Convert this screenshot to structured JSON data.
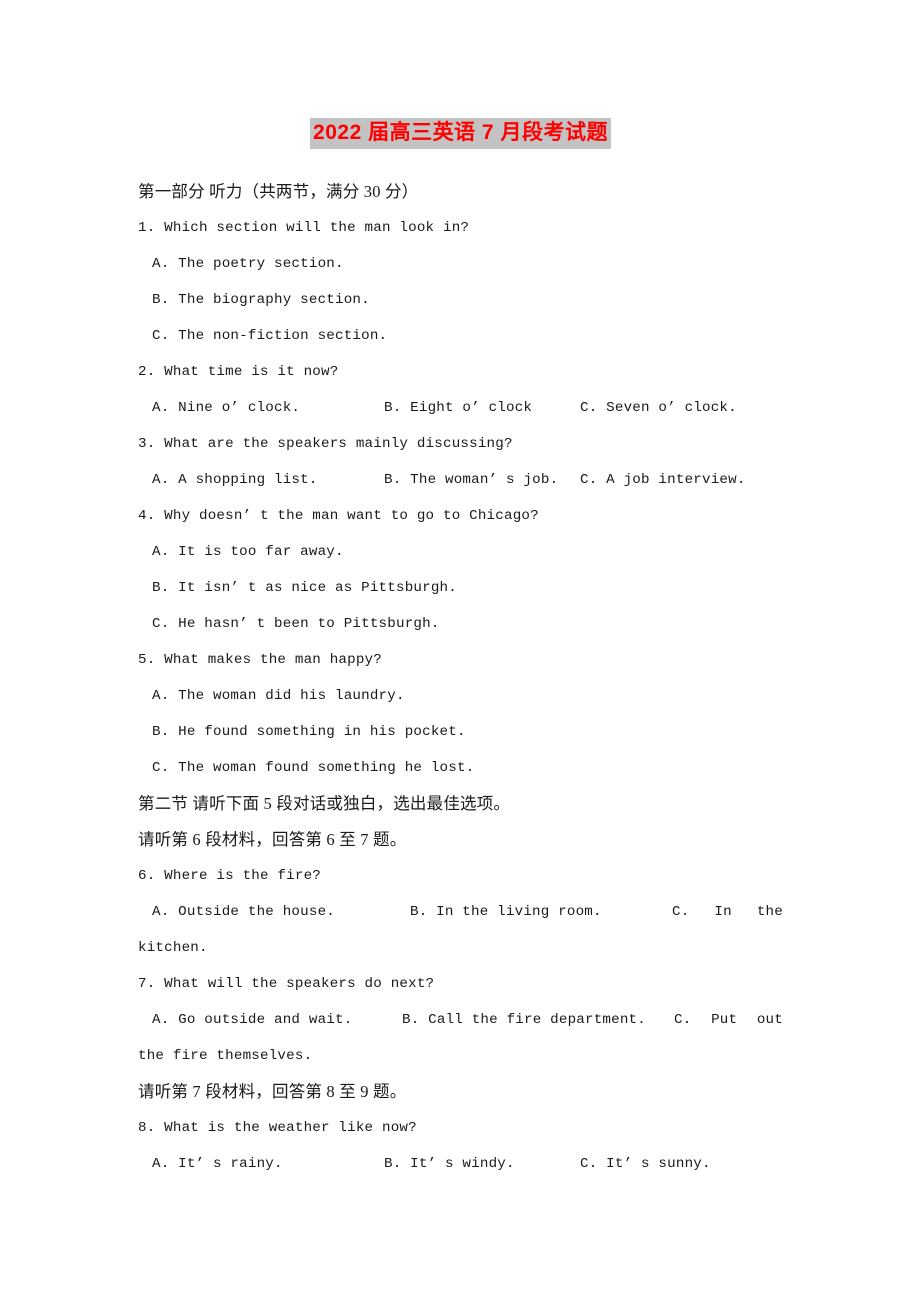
{
  "document": {
    "title": "2022 届高三英语 7 月段考试题",
    "title_color": "#ff0000",
    "title_highlight_color": "#c3c3c3",
    "background_color": "#ffffff",
    "text_color": "#1a1a1a"
  },
  "section": {
    "part_one": "第一部分   听力（共两节，满分 30 分）",
    "part_two": "第二节 请听下面 5 段对话或独白，选出最佳选项。",
    "material_6": "请听第 6 段材料，回答第 6 至 7 题。",
    "material_7": "请听第 7 段材料，回答第 8 至 9 题。"
  },
  "questions": [
    {
      "number": "1.",
      "stem": "1. Which section will the man look in?",
      "layout": "stacked",
      "options": [
        "A. The poetry section.",
        "B. The biography section.",
        "C. The non-fiction section."
      ]
    },
    {
      "number": "2.",
      "stem": "2. What time is it now?",
      "layout": "row",
      "options": [
        "A. Nine o’ clock.",
        "B. Eight o’ clock",
        "C. Seven o’ clock."
      ]
    },
    {
      "number": "3.",
      "stem": "3. What are the speakers mainly discussing?",
      "layout": "row",
      "options": [
        "A. A shopping list.",
        "B. The woman’ s job.",
        "C. A job interview."
      ]
    },
    {
      "number": "4.",
      "stem": "4. Why doesn’ t the man want to go to Chicago?",
      "layout": "stacked",
      "options": [
        "A. It is too far away.",
        "B. It isn’ t as nice as Pittsburgh.",
        "C. He hasn’ t been to Pittsburgh."
      ]
    },
    {
      "number": "5.",
      "stem": "5. What makes the man happy?",
      "layout": "stacked",
      "options": [
        "A. The woman did his laundry.",
        "B. He found something in his pocket.",
        "C. The woman found something he lost."
      ]
    },
    {
      "number": "6.",
      "stem": "6. Where is the fire?",
      "layout": "row-wrapped",
      "options": [
        "A. Outside the house.",
        "B. In the living room.",
        "C.",
        "In",
        "the"
      ],
      "wrap": "kitchen."
    },
    {
      "number": "7.",
      "stem": "7. What will the speakers do next?",
      "layout": "row-wrapped",
      "options": [
        "A. Go outside and wait.",
        "B. Call the fire department.",
        "C.",
        "Put",
        "out"
      ],
      "wrap": "the fire themselves."
    },
    {
      "number": "8.",
      "stem": "8. What is the weather like now?",
      "layout": "row",
      "options": [
        "A. It’ s rainy.",
        "B. It’ s windy.",
        "C. It’ s sunny."
      ]
    }
  ]
}
